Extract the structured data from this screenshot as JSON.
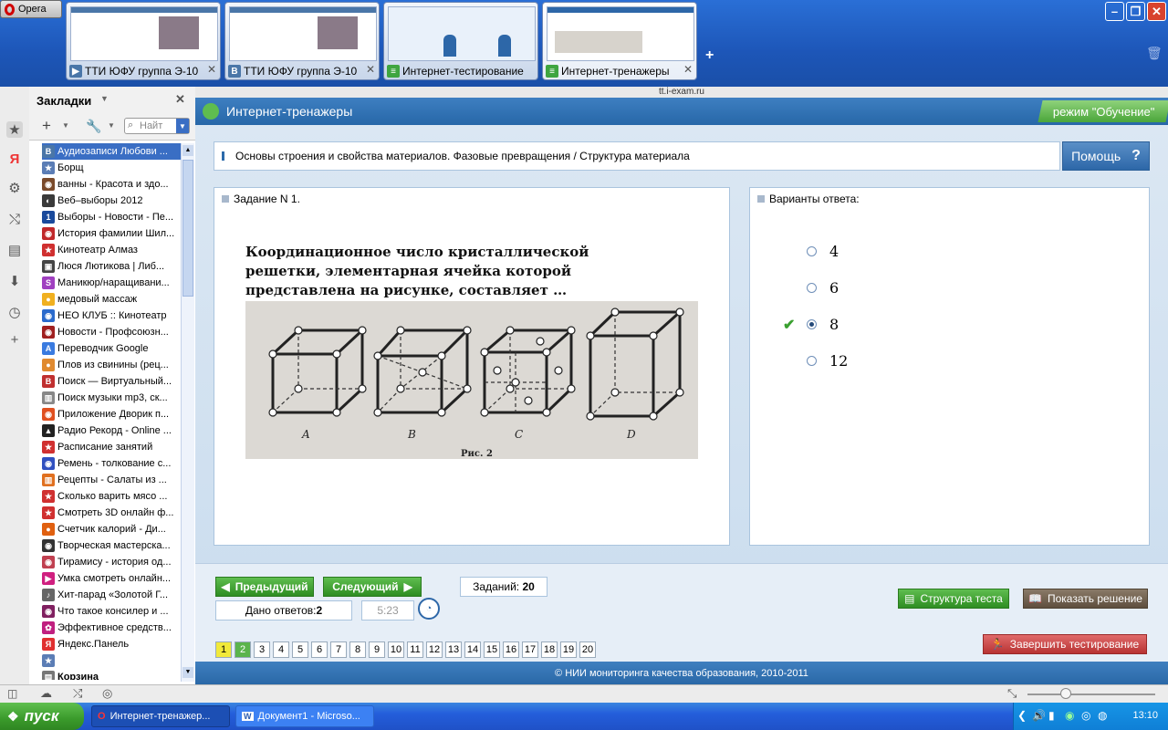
{
  "browser": {
    "menu_label": "Opera",
    "tabs": [
      {
        "label": "ТТИ ЮФУ группа Э-10",
        "icon": "vk-icon"
      },
      {
        "label": "ТТИ ЮФУ группа Э-10",
        "icon": "vk-icon"
      },
      {
        "label": "Интернет-тестирование",
        "icon": "i-exam-icon"
      },
      {
        "label": "Интернет-тренажеры",
        "icon": "i-exam-icon",
        "active": true
      }
    ],
    "address": "tt.i-exam.ru"
  },
  "bookmarks_panel": {
    "title": "Закладки",
    "search_placeholder": "Найт",
    "items": [
      {
        "label": "Аудиозаписи Любови ...",
        "color": "#4a76a8",
        "glyph": "В",
        "selected": true
      },
      {
        "label": "Борщ",
        "color": "#5b7db5",
        "glyph": "★"
      },
      {
        "label": "ванны - Красота и здо...",
        "color": "#7a4a2a",
        "glyph": "◉"
      },
      {
        "label": "Веб–выборы 2012",
        "color": "#3a3a3a",
        "glyph": "◐"
      },
      {
        "label": "Выборы - Новости - Пе...",
        "color": "#1a4a9c",
        "glyph": "1"
      },
      {
        "label": "История фамилии Шил...",
        "color": "#c0282a",
        "glyph": "◉"
      },
      {
        "label": "Кинотеатр Алмаз",
        "color": "#d03030",
        "glyph": "★"
      },
      {
        "label": "Люся Лютикова | Либ...",
        "color": "#444",
        "glyph": "▣"
      },
      {
        "label": "Маникюр/наращивани...",
        "color": "#a040c0",
        "glyph": "S"
      },
      {
        "label": "медовый массаж",
        "color": "#f0b020",
        "glyph": "●"
      },
      {
        "label": "НЕО КЛУБ :: Кинотеатр",
        "color": "#2a6acc",
        "glyph": "◉"
      },
      {
        "label": "Новости - Профсоюзн...",
        "color": "#a02020",
        "glyph": "◉"
      },
      {
        "label": "Переводчик Google",
        "color": "#3a7be0",
        "glyph": "A"
      },
      {
        "label": "Плов из свинины (рец...",
        "color": "#e08a30",
        "glyph": "●"
      },
      {
        "label": "Поиск — Виртуальный...",
        "color": "#c03030",
        "glyph": "В"
      },
      {
        "label": "Поиск музыки mp3, ск...",
        "color": "#888",
        "glyph": "▥"
      },
      {
        "label": "Приложение Дворик п...",
        "color": "#e05020",
        "glyph": "◉"
      },
      {
        "label": "Радио Рекорд - Online ...",
        "color": "#222",
        "glyph": "▲"
      },
      {
        "label": "Расписание занятий",
        "color": "#d03030",
        "glyph": "★"
      },
      {
        "label": "Ремень - толкование с...",
        "color": "#3050c0",
        "glyph": "◉"
      },
      {
        "label": "Рецепты - Салаты из ...",
        "color": "#e07020",
        "glyph": "▥"
      },
      {
        "label": "Сколько варить мясо ...",
        "color": "#d03030",
        "glyph": "★"
      },
      {
        "label": "Смотреть 3D онлайн ф...",
        "color": "#d03030",
        "glyph": "★"
      },
      {
        "label": "Счетчик калорий - Ди...",
        "color": "#e06010",
        "glyph": "●"
      },
      {
        "label": "Творческая мастерска...",
        "color": "#333",
        "glyph": "◉"
      },
      {
        "label": "Тирамису - история од...",
        "color": "#c04050",
        "glyph": "◉"
      },
      {
        "label": "Умка смотреть онлайн...",
        "color": "#d02080",
        "glyph": "▶"
      },
      {
        "label": "Хит-парад «Золотой Г...",
        "color": "#666",
        "glyph": "♪"
      },
      {
        "label": "Что такое консилер и ...",
        "color": "#802060",
        "glyph": "◉"
      },
      {
        "label": "Эффективное средств...",
        "color": "#c02080",
        "glyph": "✿"
      },
      {
        "label": "Яндекс.Панель",
        "color": "#e03030",
        "glyph": "Я"
      },
      {
        "label": "",
        "color": "#5b7db5",
        "glyph": "★"
      },
      {
        "label": "Корзина",
        "color": "#777",
        "glyph": "▤"
      }
    ]
  },
  "site": {
    "title": "Интернет-тренажеры",
    "mode": "режим \"Обучение\"",
    "breadcrumb": "Основы строения и свойства материалов. Фазовые превращения / Структура материала",
    "help_label": "Помощь",
    "task_header": "Задание N 1.",
    "question": "Координационное число кристаллической решетки, элементарная ячейка которой представлена на рисунке, составляет …",
    "figure": {
      "caption": "Рис. 2",
      "labels": [
        "A",
        "B",
        "C",
        "D"
      ]
    },
    "answers_header": "Варианты ответа:",
    "answers": [
      {
        "label": "4",
        "selected": false
      },
      {
        "label": "6",
        "selected": false
      },
      {
        "label": "8",
        "selected": true,
        "correct": true
      },
      {
        "label": "12",
        "selected": false
      }
    ],
    "nav": {
      "prev_label": "Предыдущий",
      "next_label": "Следующий",
      "tasks_label": "Заданий:",
      "tasks_count": "20",
      "answered_label": "Дано ответов:",
      "answered_count": "2",
      "timer": "5:23",
      "structure_label": "Структура теста",
      "solution_label": "Показать решение",
      "finish_label": "Завершить тестирование",
      "pages": [
        "1",
        "2",
        "3",
        "4",
        "5",
        "6",
        "7",
        "8",
        "9",
        "10",
        "11",
        "12",
        "13",
        "14",
        "15",
        "16",
        "17",
        "18",
        "19",
        "20"
      ],
      "current_page": "1",
      "done_pages": [
        "2"
      ]
    },
    "footer": "© НИИ мониторинга качества образования, 2010-2011"
  },
  "taskbar": {
    "start_label": "пуск",
    "tasks": [
      {
        "label": "Интернет-тренажер...",
        "icon": "opera-icon"
      },
      {
        "label": "Документ1 - Microso...",
        "icon": "word-icon"
      }
    ],
    "clock": "13:10"
  }
}
